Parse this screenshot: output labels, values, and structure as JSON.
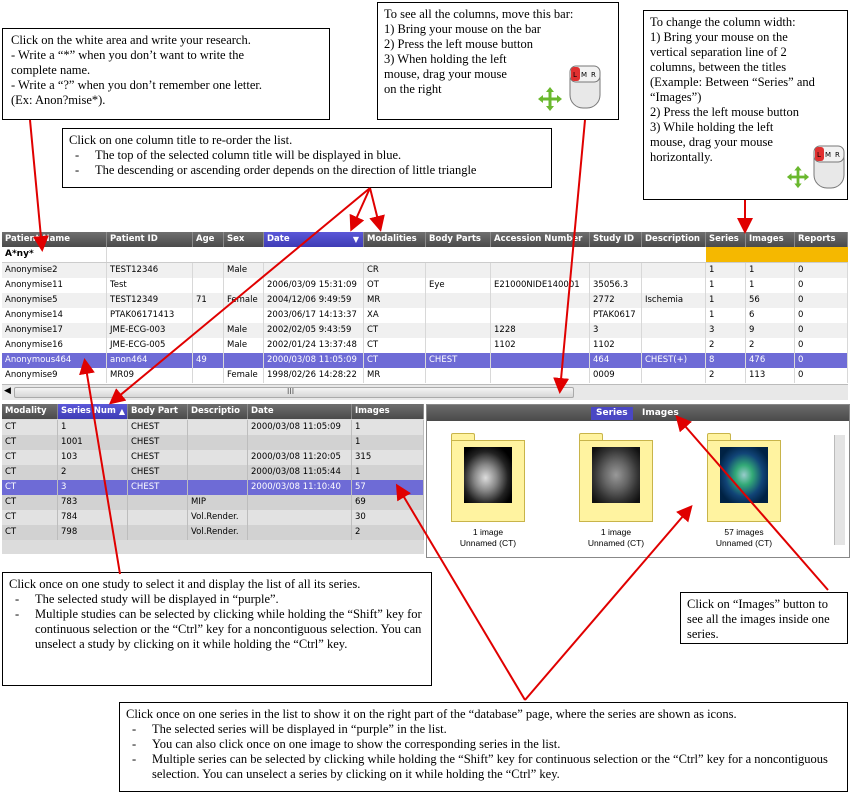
{
  "notes": {
    "search": {
      "lines": [
        "Click on the white area and write your research.",
        "- Write a “*” when you don’t want to write the",
        "complete name.",
        "- Write a “?” when you don’t remember one letter.",
        "(Ex: Anon?mise*)."
      ]
    },
    "scroll": {
      "lines": [
        "To see all the columns, move this bar:",
        "1) Bring your mouse on the bar",
        "2) Press the left mouse button",
        "3) When holding the left",
        "mouse, drag your mouse",
        "on the right"
      ]
    },
    "width": {
      "lines": [
        "To change the column width:",
        "1) Bring your mouse on the",
        "vertical separation line of 2",
        "columns, between the titles",
        "(Example: Between “Series” and",
        "“Images”)",
        "2) Press the left mouse button",
        "3) While holding the left",
        "mouse, drag your mouse",
        "horizontally."
      ]
    },
    "reorder": {
      "title": "Click on one column title to re-order the list.",
      "items": [
        "The top of the selected column title will be displayed in blue.",
        "The descending or ascending order depends on the direction of little triangle"
      ]
    },
    "study": {
      "title": "Click once on one study to select it and display the list of all its series.",
      "items": [
        "The selected study will be displayed in “purple”.",
        "Multiple studies can be selected by clicking while holding the “Shift” key for continuous selection or the “Ctrl” key for a noncontiguous selection. You can unselect a study by clicking on it while holding the “Ctrl” key."
      ]
    },
    "images_btn": {
      "text": "Click on “Images” button to see all the images inside one series."
    },
    "series": {
      "title": "Click once on one series in the list to show it on the right part of the “database” page, where the series are shown as icons.",
      "items": [
        "The selected series will be displayed in “purple” in the list.",
        "You can also click once on one image to show the corresponding series in the list.",
        "Multiple series can be selected by clicking while holding the “Shift” key for continuous selection or the “Ctrl” key for a noncontiguous selection. You can unselect a series by clicking on it while holding the “Ctrl” key."
      ]
    }
  },
  "mouse_icon": {
    "left": "L",
    "middle": "M",
    "right": "R"
  },
  "studies": {
    "headers": [
      "Patient Name",
      "Patient ID",
      "Age",
      "Sex",
      "Date",
      "Modalities",
      "Body Parts",
      "Accession Number",
      "Study ID",
      "Description",
      "Series",
      "Images",
      "Reports"
    ],
    "sorted_column": "Date",
    "filter_value": "A*ny*",
    "rows": [
      [
        "Anonymise2",
        "TEST12346",
        "",
        "Male",
        "",
        "CR",
        "",
        "",
        "",
        "",
        "1",
        "1",
        "0"
      ],
      [
        "Anonymise11",
        "Test",
        "",
        "",
        "2006/03/09 15:31:09",
        "OT",
        "Eye",
        "E21000NIDE140001",
        "35056.3",
        "",
        "1",
        "1",
        "0"
      ],
      [
        "Anonymise5",
        "TEST12349",
        "71",
        "Female",
        "2004/12/06 9:49:59",
        "MR",
        "",
        "",
        "2772",
        "Ischemia",
        "1",
        "56",
        "0"
      ],
      [
        "Anonymise14",
        "PTAK06171413",
        "",
        "",
        "2003/06/17 14:13:37",
        "XA",
        "",
        "",
        "PTAK0617",
        "",
        "1",
        "6",
        "0"
      ],
      [
        "Anonymise17",
        "JME-ECG-003",
        "",
        "Male",
        "2002/02/05 9:43:59",
        "CT",
        "",
        "1228",
        "3",
        "",
        "3",
        "9",
        "0"
      ],
      [
        "Anonymise16",
        "JME-ECG-005",
        "",
        "Male",
        "2002/01/24 13:37:48",
        "CT",
        "",
        "1102",
        "1102",
        "",
        "2",
        "2",
        "0"
      ],
      [
        "Anonymous464",
        "anon464",
        "49",
        "",
        "2000/03/08 11:05:09",
        "CT",
        "CHEST",
        "",
        "464",
        "CHEST(+)",
        "8",
        "476",
        "0"
      ],
      [
        "Anonymise9",
        "MR09",
        "",
        "Female",
        "1998/02/26 14:28:22",
        "MR",
        "",
        "",
        "0009",
        "",
        "2",
        "113",
        "0"
      ]
    ],
    "selected_row": 6,
    "scroll_grip": "III"
  },
  "series": {
    "headers": [
      "Modality",
      "Series Num",
      "Body Part",
      "Descriptio",
      "Date",
      "Images"
    ],
    "sorted_column": "Series Num",
    "rows": [
      [
        "CT",
        "1",
        "CHEST",
        "",
        "2000/03/08 11:05:09",
        "1"
      ],
      [
        "CT",
        "1001",
        "CHEST",
        "",
        "",
        "1"
      ],
      [
        "CT",
        "103",
        "CHEST",
        "",
        "2000/03/08 11:20:05",
        "315"
      ],
      [
        "CT",
        "2",
        "CHEST",
        "",
        "2000/03/08 11:05:44",
        "1"
      ],
      [
        "CT",
        "3",
        "CHEST",
        "",
        "2000/03/08 11:10:40",
        "57"
      ],
      [
        "CT",
        "783",
        "",
        "MIP",
        "",
        "69"
      ],
      [
        "CT",
        "784",
        "",
        "Vol.Render.",
        "",
        "30"
      ],
      [
        "CT",
        "798",
        "",
        "Vol.Render.",
        "",
        "2"
      ]
    ],
    "selected_row": 4
  },
  "icon_view": {
    "tabs": [
      "Series",
      "Images"
    ],
    "active_tab": "Series",
    "items": [
      {
        "count": "1 image",
        "name": "Unnamed (CT)"
      },
      {
        "count": "1 image",
        "name": "Unnamed (CT)"
      },
      {
        "count": "57 images",
        "name": "Unnamed (CT)"
      }
    ]
  },
  "colors": {
    "selected_row": "#6e6bd6",
    "header": "#555555",
    "sorted_header": "#4a47c4",
    "filter_bar": "#f5b800",
    "arrow": "#e00000",
    "folder": "#fff3a0"
  }
}
